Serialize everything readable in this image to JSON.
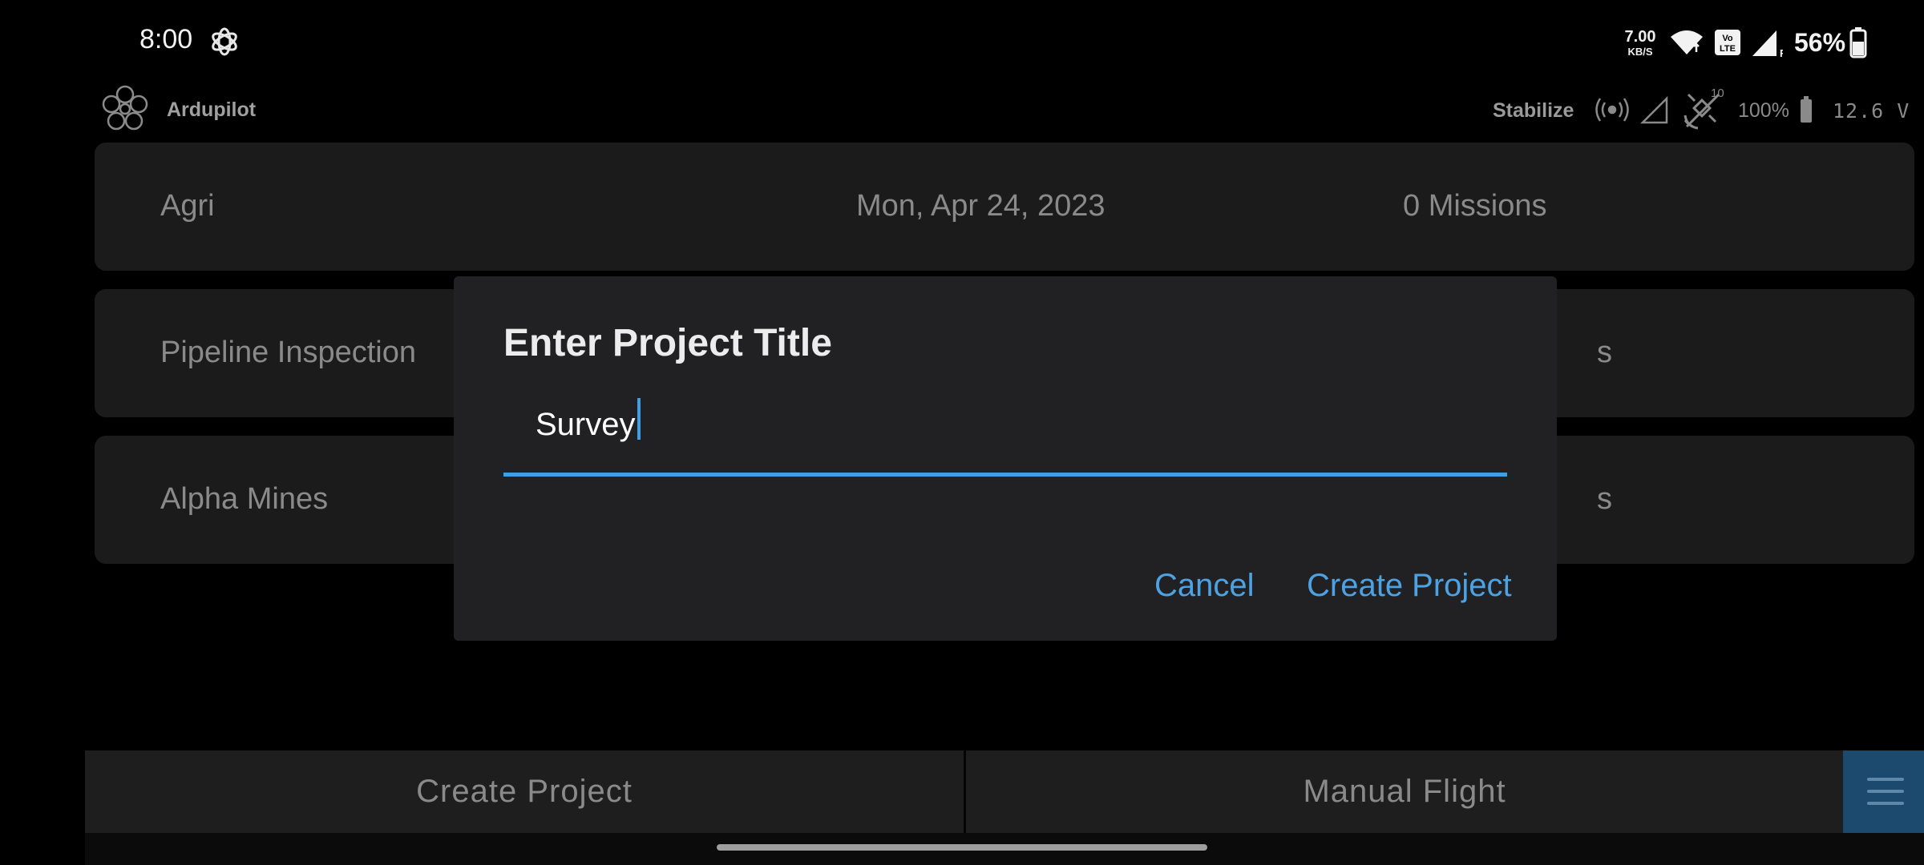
{
  "status_bar": {
    "time": "8:00",
    "net_speed_value": "7.00",
    "net_speed_unit": "KB/S",
    "battery_percent": "56%",
    "icons": [
      "app-notification-icon",
      "wifi-icon",
      "volte-icon",
      "cell-signal-icon",
      "battery-icon"
    ]
  },
  "app_bar": {
    "app_name": "Ardupilot",
    "flight_mode": "Stabilize",
    "gps_satellites": "10",
    "drone_battery": "100%",
    "voltage": "12.6 V",
    "icons": [
      "drone-logo-icon",
      "telemetry-icon",
      "signal-icon",
      "gps-icon",
      "drone-battery-icon"
    ]
  },
  "projects": [
    {
      "name": "Agri",
      "date": "Mon, Apr 24, 2023",
      "missions": "0 Missions"
    },
    {
      "name": "Pipeline Inspection",
      "date": "",
      "missions": "s"
    },
    {
      "name": "Alpha Mines",
      "date": "",
      "missions": "s"
    }
  ],
  "bottom_bar": {
    "create_project": "Create Project",
    "manual_flight": "Manual Flight",
    "menu_icon": "hamburger-menu-icon"
  },
  "dialog": {
    "title": "Enter Project Title",
    "input_value": "Survey",
    "cancel": "Cancel",
    "confirm": "Create Project"
  },
  "colors": {
    "accent": "#3e9ee6",
    "dialog_bg": "#212123",
    "card_bg": "#1b1b1c",
    "menu_button_bg": "#1c4a6e"
  }
}
